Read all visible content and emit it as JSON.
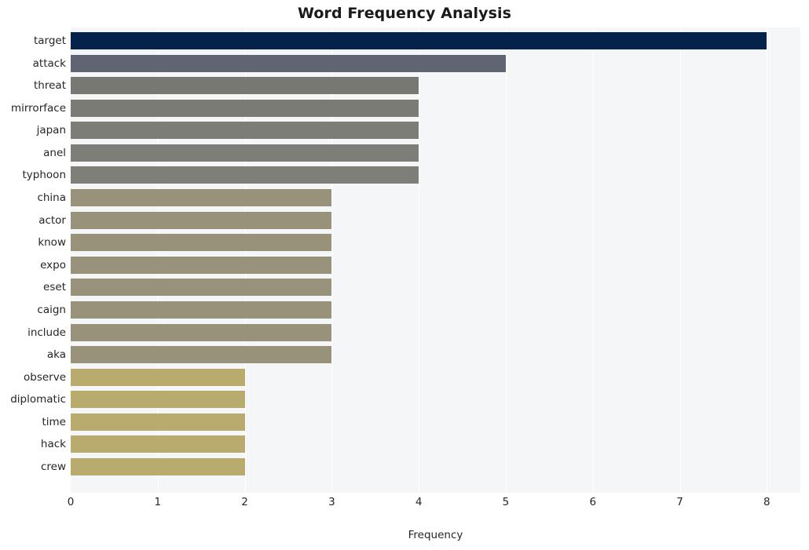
{
  "chart_data": {
    "type": "bar",
    "orientation": "horizontal",
    "title": "Word Frequency Analysis",
    "xlabel": "Frequency",
    "ylabel": "",
    "xlim": [
      0,
      8.385
    ],
    "xticks": [
      0,
      1,
      2,
      3,
      4,
      5,
      6,
      7,
      8
    ],
    "xtick_labels": [
      "0",
      "1",
      "2",
      "3",
      "4",
      "5",
      "6",
      "7",
      "8"
    ],
    "grid": "vertical-only",
    "legend": "none",
    "categories": [
      "target",
      "attack",
      "threat",
      "mirrorface",
      "japan",
      "anel",
      "typhoon",
      "china",
      "actor",
      "know",
      "expo",
      "eset",
      "caign",
      "include",
      "aka",
      "observe",
      "diplomatic",
      "time",
      "hack",
      "crew"
    ],
    "values": [
      8,
      5,
      4,
      4,
      4,
      4,
      4,
      3,
      3,
      3,
      3,
      3,
      3,
      3,
      3,
      2,
      2,
      2,
      2,
      2
    ],
    "bar_colors": [
      "#04224c",
      "#5f6572",
      "#777773",
      "#7b7b76",
      "#7d7d78",
      "#7e7e78",
      "#7f7f79",
      "#99927a",
      "#99927a",
      "#99927a",
      "#99927a",
      "#99927a",
      "#99927a",
      "#99927a",
      "#99927a",
      "#b9ab6e",
      "#b9ab6e",
      "#b9ab6e",
      "#b9ab6e",
      "#b9ab6e"
    ],
    "plot_background": "#f5f6f7",
    "gridline_color": "#ffffff",
    "figure_background": "#ffffff"
  }
}
